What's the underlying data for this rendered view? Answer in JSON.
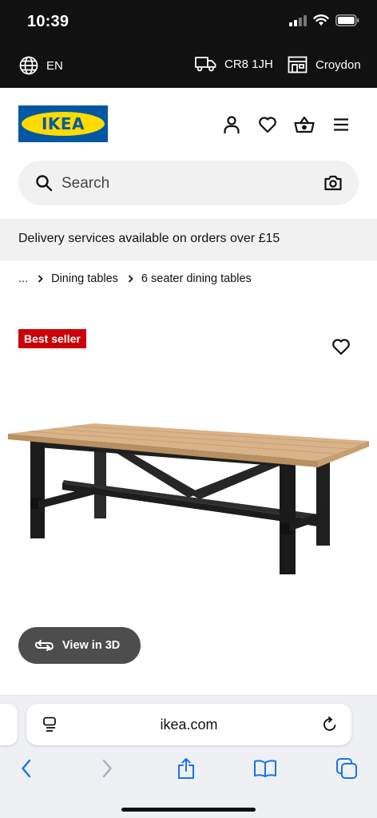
{
  "status_bar": {
    "time": "10:39"
  },
  "top_bar": {
    "language": "EN",
    "postcode": "CR8 1JH",
    "store": "Croydon"
  },
  "header": {
    "logo_text": "IKEA",
    "icons": [
      "account-icon",
      "heart-icon",
      "basket-icon",
      "menu-icon"
    ]
  },
  "search": {
    "placeholder": "Search"
  },
  "banner": {
    "text": "Delivery services available on orders over £15"
  },
  "breadcrumb": {
    "ellipsis": "...",
    "items": [
      "Dining tables",
      "6 seater dining tables"
    ]
  },
  "product": {
    "badge": "Best seller",
    "view3d_label": "View in 3D"
  },
  "browser": {
    "url": "ikea.com"
  },
  "colors": {
    "ikea_blue": "#0058a3",
    "ikea_yellow": "#ffdb00",
    "badge_red": "#cc0008",
    "ios_blue": "#1a73e8"
  }
}
